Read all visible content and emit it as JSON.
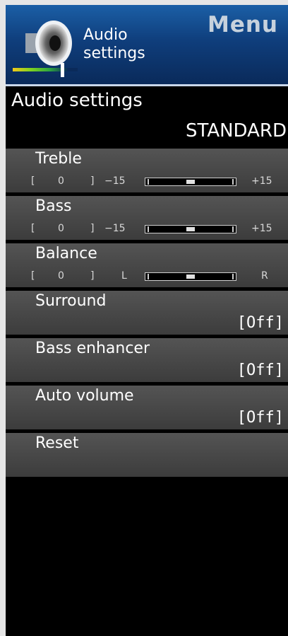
{
  "header": {
    "menu_title": "Menu",
    "subtitle_line1": "Audio",
    "subtitle_line2": "settings",
    "icon": "speaker-icon"
  },
  "section_title": "Audio settings",
  "mode_value": "STANDARD",
  "sliders": [
    {
      "label": "Treble",
      "bracket_open": "[",
      "value": "0",
      "bracket_close": "]",
      "min_label": "−15",
      "max_label": "+15",
      "level": 0.5
    },
    {
      "label": "Bass",
      "bracket_open": "[",
      "value": "0",
      "bracket_close": "]",
      "min_label": "−15",
      "max_label": "+15",
      "level": 0.5
    },
    {
      "label": "Balance",
      "bracket_open": "[",
      "value": "0",
      "bracket_close": "]",
      "min_label": "L",
      "max_label": "R",
      "level": 0.5
    }
  ],
  "options": [
    {
      "label": "Surround",
      "value": "[Off]"
    },
    {
      "label": "Bass enhancer",
      "value": "[Off]"
    },
    {
      "label": "Auto volume",
      "value": "[Off]"
    }
  ],
  "reset": {
    "label": "Reset"
  },
  "colors": {
    "header": "#0f3e7c",
    "item": "#4a4a4a",
    "background": "#000000"
  }
}
